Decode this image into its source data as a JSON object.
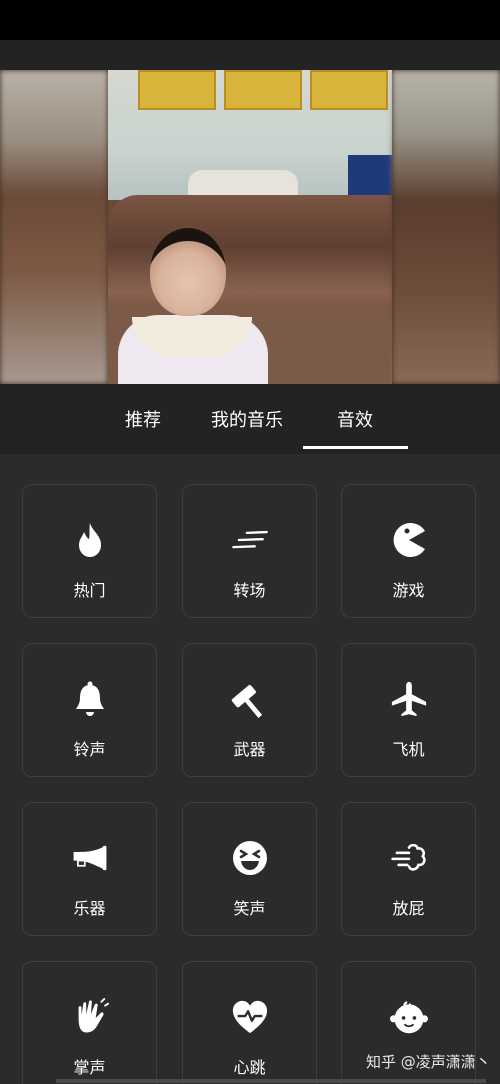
{
  "tabs": [
    {
      "label": "推荐",
      "active": false
    },
    {
      "label": "我的音乐",
      "active": false
    },
    {
      "label": "音效",
      "active": true
    }
  ],
  "categories": [
    {
      "label": "热门",
      "icon": "flame-icon"
    },
    {
      "label": "转场",
      "icon": "swoosh-lines-icon"
    },
    {
      "label": "游戏",
      "icon": "pacman-icon"
    },
    {
      "label": "铃声",
      "icon": "bell-icon"
    },
    {
      "label": "武器",
      "icon": "hammer-icon"
    },
    {
      "label": "飞机",
      "icon": "airplane-icon"
    },
    {
      "label": "乐器",
      "icon": "horn-icon"
    },
    {
      "label": "笑声",
      "icon": "laughing-face-icon"
    },
    {
      "label": "放屁",
      "icon": "gust-icon"
    },
    {
      "label": "掌声",
      "icon": "clapping-hand-icon"
    },
    {
      "label": "心跳",
      "icon": "heartbeat-icon"
    },
    {
      "label": "",
      "icon": "baby-face-icon"
    }
  ],
  "watermark": "知乎 @凌声潇潇丶",
  "colors": {
    "background": "#2b2b2b",
    "card_border": "#3e3e3e",
    "accent": "#ffffff"
  }
}
